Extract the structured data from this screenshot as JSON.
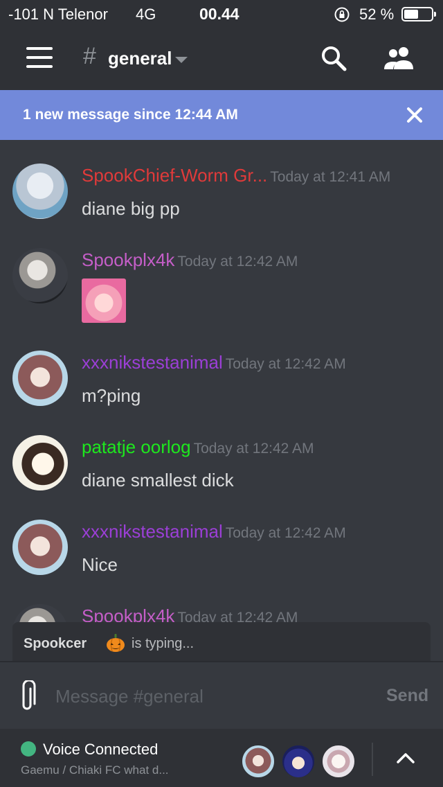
{
  "status_bar": {
    "carrier": "-101 N Telenor",
    "network": "4G",
    "time": "00.44",
    "battery_percent": "52 %",
    "battery_level": 0.52
  },
  "header": {
    "channel_hash": "#",
    "channel_name": "general",
    "icons": [
      "hamburger-menu-icon",
      "search-icon",
      "members-icon"
    ]
  },
  "banner": {
    "text": "1 new message since 12:44 AM",
    "color": "#7289da"
  },
  "messages": [
    {
      "author": "SpookChief-Worm Gr...",
      "timestamp": "Today at 12:41 AM",
      "content": "diane big pp",
      "color": "#e03a3a"
    },
    {
      "author": "Spookplx4k",
      "timestamp": "Today at 12:42 AM",
      "content": "",
      "color": "#c55ec8",
      "has_image": true
    },
    {
      "author": "xxxnikstestanimal",
      "timestamp": "Today at 12:42 AM",
      "content": "m?ping",
      "color": "#9b3fd6"
    },
    {
      "author": "patatje oorlog",
      "timestamp": "Today at 12:42 AM",
      "content": "diane smallest dick",
      "color": "#1ee81e"
    },
    {
      "author": "xxxnikstestanimal",
      "timestamp": "Today at 12:42 AM",
      "content": "Nice",
      "color": "#9b3fd6"
    },
    {
      "author": "Spookplx4k",
      "timestamp": "Today at 12:42 AM",
      "content": "",
      "color": "#c55ec8"
    }
  ],
  "typing": {
    "user": "Spookcer",
    "text": "is typing..."
  },
  "composer": {
    "placeholder": "Message #general",
    "send_label": "Send"
  },
  "voice": {
    "status": "Voice Connected",
    "channel": "Gaemu / Chiaki FC what d...",
    "indicator_color": "#43b581"
  }
}
